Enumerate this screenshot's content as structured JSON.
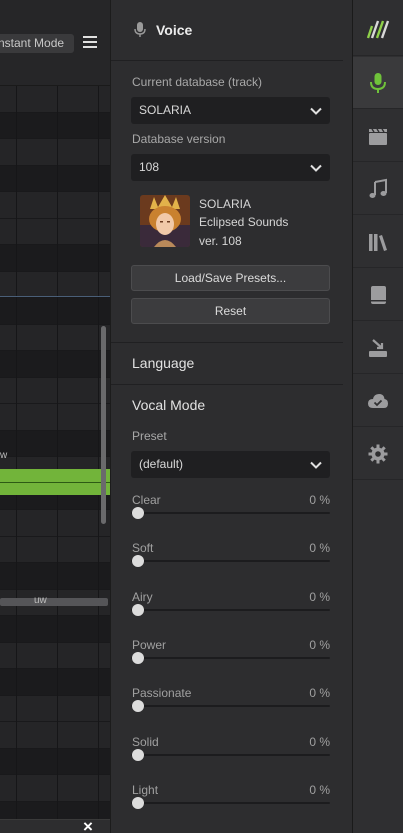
{
  "colors": {
    "accent": "#72b43a",
    "panel_bg": "#2d2d2f",
    "dropdown_bg": "#1f1f21"
  },
  "roll": {
    "mode_label": "nstant Mode",
    "lyric_w": "w",
    "lyric_uw": "uw"
  },
  "panel": {
    "title": "Voice",
    "current_db_label": "Current database (track)",
    "current_db_value": "SOLARIA",
    "db_version_label": "Database version",
    "db_version_value": "108",
    "voice_name": "SOLARIA",
    "voice_vendor": "Eclipsed Sounds",
    "voice_ver": "ver. 108",
    "load_save_button": "Load/Save Presets...",
    "reset_button": "Reset",
    "language_title": "Language",
    "vocal_mode_title": "Vocal Mode",
    "preset_label": "Preset",
    "preset_value": "(default)"
  },
  "sliders": [
    {
      "name": "Clear",
      "value": "0 %",
      "level": 0
    },
    {
      "name": "Soft",
      "value": "0 %",
      "level": 0
    },
    {
      "name": "Airy",
      "value": "0 %",
      "level": 0
    },
    {
      "name": "Power",
      "value": "0 %",
      "level": 0
    },
    {
      "name": "Passionate",
      "value": "0 %",
      "level": 0
    },
    {
      "name": "Solid",
      "value": "0 %",
      "level": 0
    },
    {
      "name": "Light",
      "value": "0 %",
      "level": 0
    }
  ],
  "iconbar": {
    "items": [
      {
        "icon": "logo-icon"
      },
      {
        "icon": "microphone-icon",
        "active": true
      },
      {
        "icon": "clapperboard-icon"
      },
      {
        "icon": "music-note-icon"
      },
      {
        "icon": "library-icon"
      },
      {
        "icon": "book-icon"
      },
      {
        "icon": "import-icon"
      },
      {
        "icon": "cloud-icon"
      },
      {
        "icon": "gear-icon"
      }
    ]
  }
}
